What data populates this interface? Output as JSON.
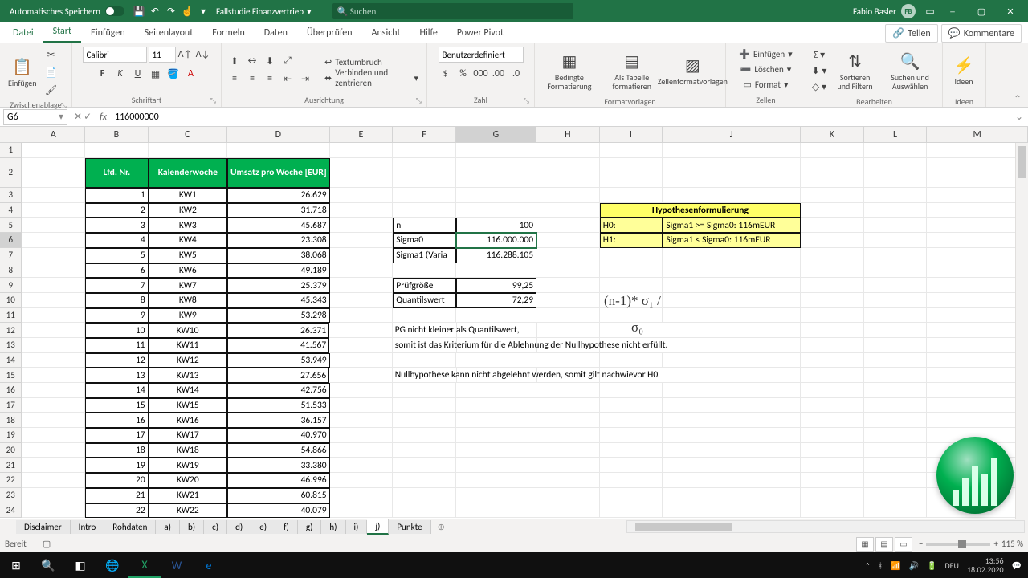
{
  "titlebar": {
    "autosave": "Automatisches Speichern",
    "filename": "Fallstudie Finanzvertrieb",
    "search_placeholder": "Suchen",
    "user": "Fabio Basler",
    "initials": "FB"
  },
  "tabs": {
    "file": "Datei",
    "start": "Start",
    "insert": "Einfügen",
    "pagelayout": "Seitenlayout",
    "formulas": "Formeln",
    "data": "Daten",
    "review": "Überprüfen",
    "view": "Ansicht",
    "help": "Hilfe",
    "powerpivot": "Power Pivot",
    "share": "Teilen",
    "comments": "Kommentare"
  },
  "ribbon": {
    "paste": "Einfügen",
    "clipboard": "Zwischenablage",
    "font_name": "Calibri",
    "font_size": "11",
    "font": "Schriftart",
    "alignment": "Ausrichtung",
    "wrap": "Textumbruch",
    "merge": "Verbinden und zentrieren",
    "number": "Zahl",
    "numfmt": "Benutzerdefiniert",
    "cond": "Bedingte Formatierung",
    "astable": "Als Tabelle formatieren",
    "cellstyles": "Zellenformatvorlagen",
    "styles": "Formatvorlagen",
    "insert_c": "Einfügen",
    "delete_c": "Löschen",
    "format_c": "Format",
    "cells": "Zellen",
    "sortfilter": "Sortieren und Filtern",
    "findselect": "Suchen und Auswählen",
    "ideas": "Ideen",
    "edit": "Bearbeiten"
  },
  "namebox": "G6",
  "formula": "116000000",
  "cols": [
    "A",
    "B",
    "C",
    "D",
    "E",
    "F",
    "G",
    "H",
    "I",
    "J",
    "K",
    "L",
    "M"
  ],
  "table_headers": {
    "b": "Lfd. Nr.",
    "c": "Kalenderwoche",
    "d": "Umsatz pro Woche [EUR]"
  },
  "rows": [
    {
      "n": "1",
      "kw": "KW1",
      "u": "26.629"
    },
    {
      "n": "2",
      "kw": "KW2",
      "u": "31.718"
    },
    {
      "n": "3",
      "kw": "KW3",
      "u": "45.687"
    },
    {
      "n": "4",
      "kw": "KW4",
      "u": "23.308"
    },
    {
      "n": "5",
      "kw": "KW5",
      "u": "38.068"
    },
    {
      "n": "6",
      "kw": "KW6",
      "u": "49.189"
    },
    {
      "n": "7",
      "kw": "KW7",
      "u": "25.379"
    },
    {
      "n": "8",
      "kw": "KW8",
      "u": "45.343"
    },
    {
      "n": "9",
      "kw": "KW9",
      "u": "53.298"
    },
    {
      "n": "10",
      "kw": "KW10",
      "u": "26.371"
    },
    {
      "n": "11",
      "kw": "KW11",
      "u": "41.567"
    },
    {
      "n": "12",
      "kw": "KW12",
      "u": "53.949"
    },
    {
      "n": "13",
      "kw": "KW13",
      "u": "27.656"
    },
    {
      "n": "14",
      "kw": "KW14",
      "u": "42.756"
    },
    {
      "n": "15",
      "kw": "KW15",
      "u": "51.533"
    },
    {
      "n": "16",
      "kw": "KW16",
      "u": "36.157"
    },
    {
      "n": "17",
      "kw": "KW17",
      "u": "40.970"
    },
    {
      "n": "18",
      "kw": "KW18",
      "u": "54.866"
    },
    {
      "n": "19",
      "kw": "KW19",
      "u": "33.380"
    },
    {
      "n": "20",
      "kw": "KW20",
      "u": "46.996"
    },
    {
      "n": "21",
      "kw": "KW21",
      "u": "60.815"
    },
    {
      "n": "22",
      "kw": "KW22",
      "u": "40.079"
    }
  ],
  "stats": {
    "n_lbl": "n",
    "n_val": "100",
    "s0_lbl": "Sigma0",
    "s0_val": "116.000.000",
    "s1_lbl": "Sigma1 (Varia",
    "s1_val": "116.288.105",
    "pg_lbl": "Prüfgröße",
    "pg_val": "99,25",
    "qw_lbl": "Quantilswert",
    "qw_val": "72,29"
  },
  "hypo": {
    "title": "Hypothesenformulierung",
    "h0_lbl": "H0:",
    "h0_val": "Sigma1 >= Sigma0: 116mEUR",
    "h1_lbl": "H1:",
    "h1_val": "Sigma1 < Sigma0: 116mEUR"
  },
  "formula_img": {
    "line1": "(n-1)* σ₁ /",
    "line2": "σ₀"
  },
  "notes": {
    "l1": "PG nicht kleiner als Quantilswert,",
    "l2": "somit ist das Kriterium für die Ablehnung der Nullhypothese nicht erfüllt.",
    "l3": "Nullhypothese kann nicht abgelehnt werden, somit gilt nachwievor H0."
  },
  "sheets": [
    "Disclaimer",
    "Intro",
    "Rohdaten",
    "a)",
    "b)",
    "c)",
    "d)",
    "e)",
    "f)",
    "g)",
    "h)",
    "i)",
    "j)",
    "Punkte"
  ],
  "status": {
    "ready": "Bereit",
    "zoom": "115 %"
  },
  "tray": {
    "lang": "DEU",
    "time": "13:56",
    "date": "18.02.2020"
  }
}
